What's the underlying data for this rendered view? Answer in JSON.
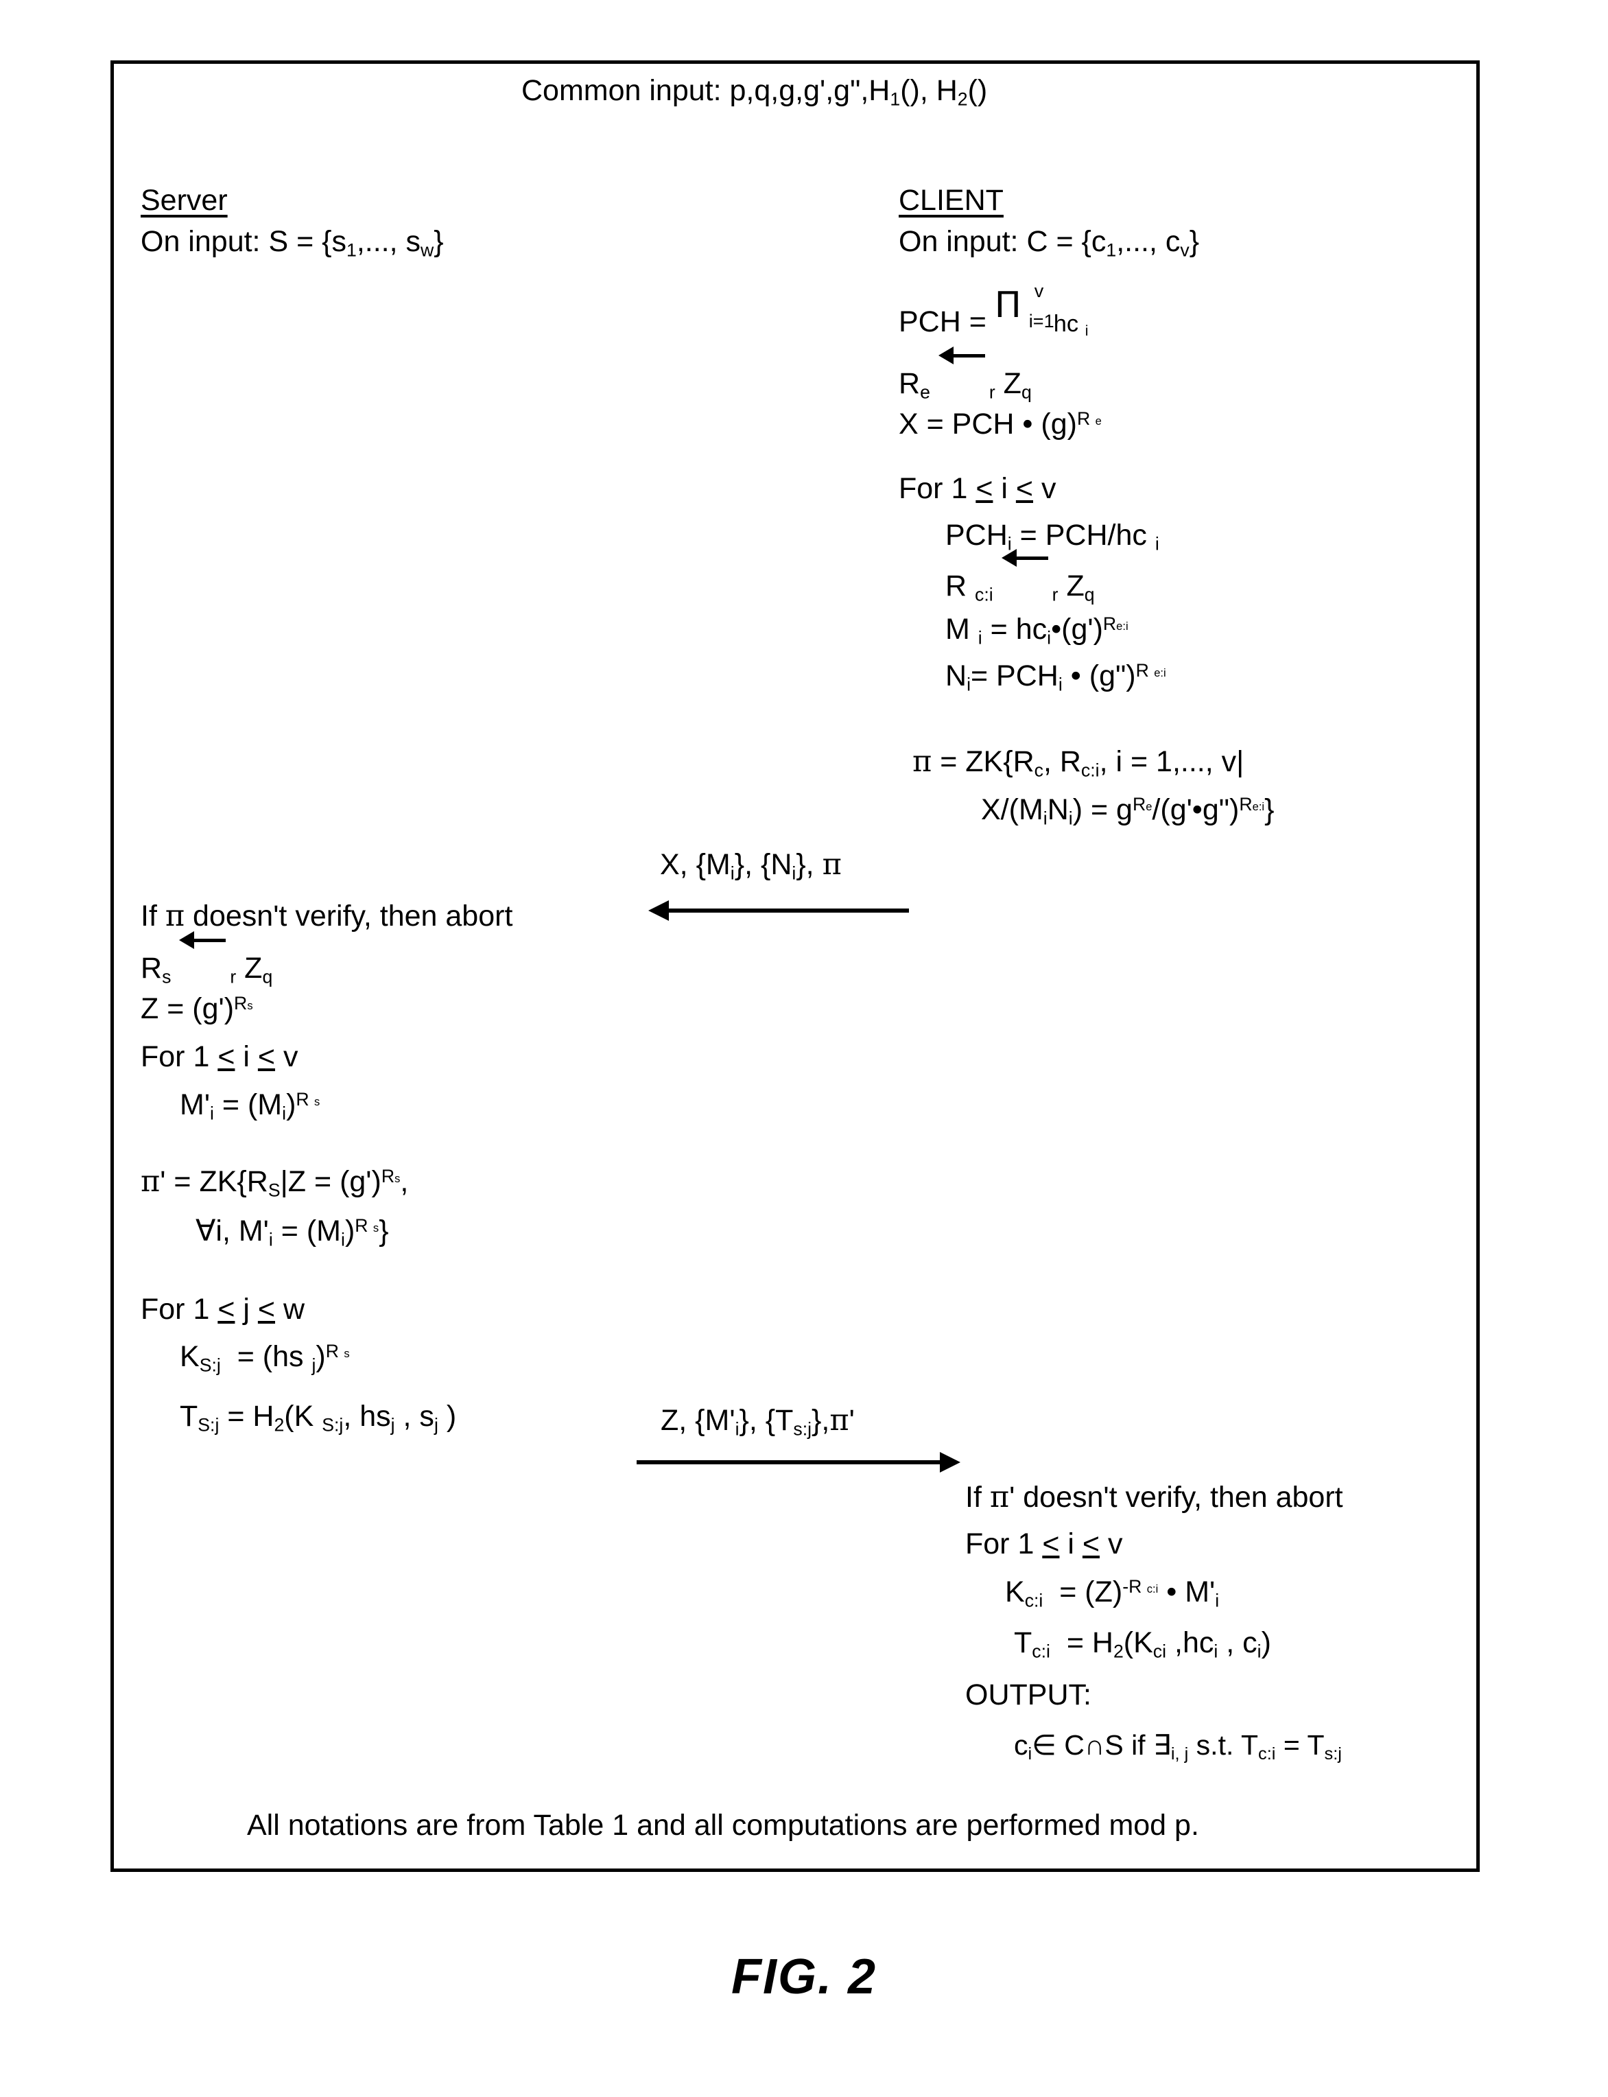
{
  "figure": {
    "caption": "FIG.  2",
    "common_input": "Common input: p,q,g,g',g\",H₁(), H₂()",
    "footer_note": "All notations are from Table 1 and all computations are performed mod p."
  },
  "server": {
    "heading": "Server",
    "on_input": "On input: S = {s₁,..., s_w}",
    "steps": [
      "If π doesn't verify, then abort",
      "R_s ←_r Z_q",
      "Z = (g')^{R_s}",
      "For 1 ≤ i ≤ v",
      "M'_i = (M_i)^{R_s}",
      "π' = ZK{R_S | Z = (g')^{R_s},",
      "∀i, M'_i = (M_i)^{R_s}}",
      "For 1 ≤ j ≤ w",
      "K_{S:j} = (hs_j)^{R_s}",
      "T_{S:j} = H₂(K_{S:j}, hs_j , s_j )"
    ]
  },
  "client": {
    "heading": "CLIENT",
    "on_input": "On input: C = {c₁,..., c_v}",
    "steps": [
      "PCH = Π_{i=1}^{v} hc_i",
      "R_e ←_r Z_q",
      "X = PCH · (g)^{R_e}",
      "For 1 ≤ i ≤ v",
      "PCH_i = PCH/hc_i",
      "R_{c:i} ←_r Z_q",
      "M_i = hc_i·(g')^{R_{e:i}}",
      "N_i = PCH_i · (g\")^{R_{e:i}}",
      "π = ZK{R_c, R_{c:i}, i = 1,..., v|",
      "X/(M_i N_i) = g^{R_e}/(g'·g\")^{R_{e:i}}}"
    ],
    "final_steps": [
      "If π' doesn't verify, then abort",
      "For 1 ≤ i ≤ v",
      "K_{c:i} = (Z)^{-R_{c:i}} · M'_i",
      "T_{c:i} = H₂(K_{ci} ,hc_i , c_i)",
      "OUTPUT:",
      "c_i ∈ C ∩ S if ∃_{i,j} s.t. T_{c:i} = T_{s:j}"
    ]
  },
  "messages": [
    {
      "label": "X, {M_i}, {N_i}, π",
      "direction": "client-to-server"
    },
    {
      "label": "Z, {M'_i}, {T_{s:j}}, π'",
      "direction": "server-to-client"
    }
  ]
}
